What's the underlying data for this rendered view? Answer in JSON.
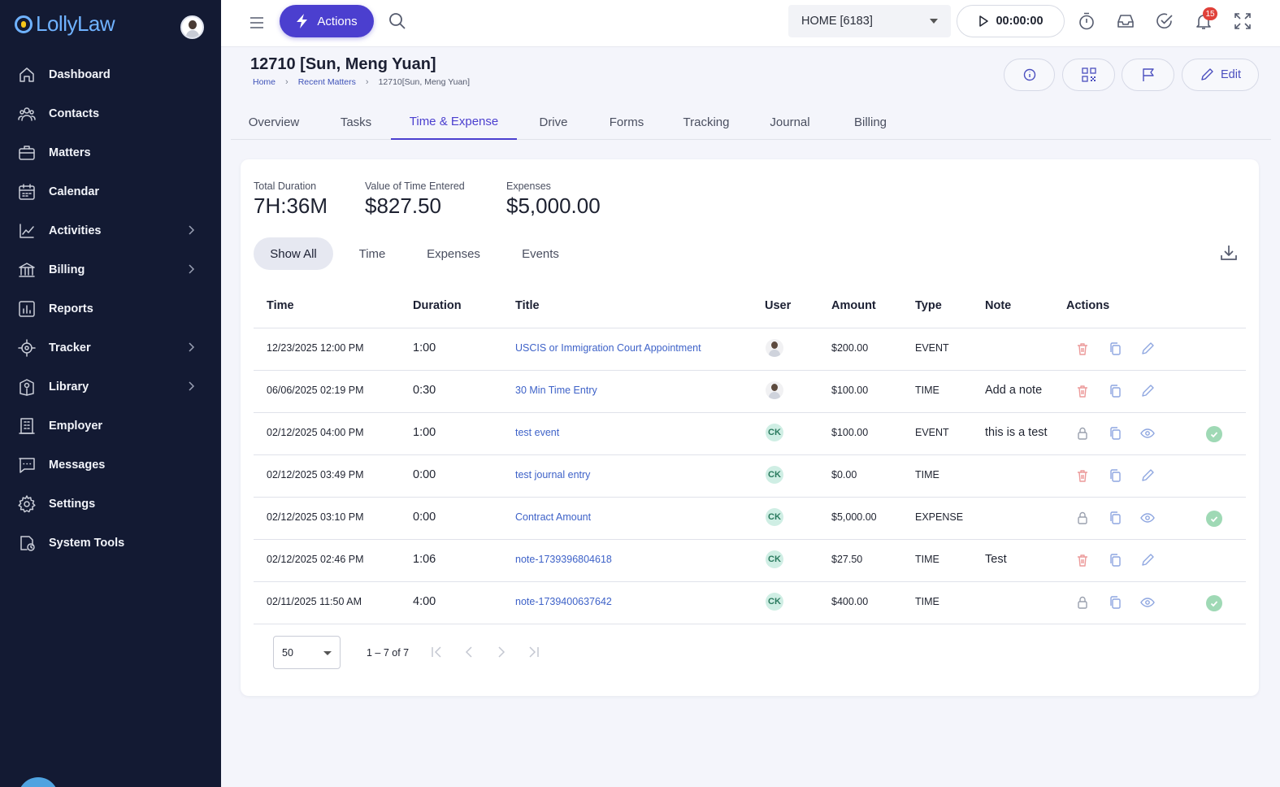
{
  "app": {
    "name": "LollyLaw"
  },
  "sidebar": {
    "items": [
      {
        "label": "Dashboard",
        "icon": "home-icon",
        "has_submenu": false
      },
      {
        "label": "Contacts",
        "icon": "contacts-icon",
        "has_submenu": false
      },
      {
        "label": "Matters",
        "icon": "briefcase-icon",
        "has_submenu": false
      },
      {
        "label": "Calendar",
        "icon": "calendar-icon",
        "has_submenu": false
      },
      {
        "label": "Activities",
        "icon": "activity-chart-icon",
        "has_submenu": true
      },
      {
        "label": "Billing",
        "icon": "bank-icon",
        "has_submenu": true
      },
      {
        "label": "Reports",
        "icon": "bar-chart-icon",
        "has_submenu": false
      },
      {
        "label": "Tracker",
        "icon": "target-icon",
        "has_submenu": true
      },
      {
        "label": "Library",
        "icon": "library-icon",
        "has_submenu": true
      },
      {
        "label": "Employer",
        "icon": "building-icon",
        "has_submenu": false
      },
      {
        "label": "Messages",
        "icon": "message-icon",
        "has_submenu": false
      },
      {
        "label": "Settings",
        "icon": "gear-icon",
        "has_submenu": false
      },
      {
        "label": "System Tools",
        "icon": "system-tools-icon",
        "has_submenu": false
      }
    ]
  },
  "topbar": {
    "actions_label": "Actions",
    "location_select": "HOME [6183]",
    "timer": "00:00:00",
    "notifications_count": "15"
  },
  "header": {
    "title": "12710 [Sun, Meng Yuan]",
    "breadcrumb": [
      "Home",
      "Recent Matters",
      "12710[Sun, Meng Yuan]"
    ],
    "edit_label": "Edit"
  },
  "tabs": [
    {
      "label": "Overview",
      "active": false
    },
    {
      "label": "Tasks",
      "active": false
    },
    {
      "label": "Time & Expense",
      "active": true
    },
    {
      "label": "Drive",
      "active": false
    },
    {
      "label": "Forms",
      "active": false
    },
    {
      "label": "Tracking",
      "active": false
    },
    {
      "label": "Journal",
      "active": false
    },
    {
      "label": "Billing",
      "active": false
    }
  ],
  "summary": {
    "total_duration": {
      "label": "Total Duration",
      "value": "7H:36M"
    },
    "time_value": {
      "label": "Value of Time Entered",
      "value": "$827.50"
    },
    "expenses": {
      "label": "Expenses",
      "value": "$5,000.00"
    }
  },
  "filters": [
    {
      "label": "Show All",
      "active": true
    },
    {
      "label": "Time",
      "active": false
    },
    {
      "label": "Expenses",
      "active": false
    },
    {
      "label": "Events",
      "active": false
    }
  ],
  "table": {
    "columns": [
      "Time",
      "Duration",
      "Title",
      "User",
      "Amount",
      "Type",
      "Note",
      "Actions"
    ],
    "rows": [
      {
        "time": "12/23/2025 12:00 PM",
        "duration": "1:00",
        "title": "USCIS or Immigration Court Appointment",
        "user": "",
        "amount": "$200.00",
        "type": "EVENT",
        "note": "",
        "locked": false,
        "approved": false
      },
      {
        "time": "06/06/2025 02:19 PM",
        "duration": "0:30",
        "title": "30 Min Time Entry",
        "user": "",
        "amount": "$100.00",
        "type": "TIME",
        "note": "Add a note",
        "locked": false,
        "approved": false
      },
      {
        "time": "02/12/2025 04:00 PM",
        "duration": "1:00",
        "title": "test event",
        "user": "CK",
        "amount": "$100.00",
        "type": "EVENT",
        "note": "this is a test",
        "locked": true,
        "approved": true
      },
      {
        "time": "02/12/2025 03:49 PM",
        "duration": "0:00",
        "title": "test journal entry",
        "user": "CK",
        "amount": "$0.00",
        "type": "TIME",
        "note": "",
        "locked": false,
        "approved": false
      },
      {
        "time": "02/12/2025 03:10 PM",
        "duration": "0:00",
        "title": "Contract Amount",
        "user": "CK",
        "amount": "$5,000.00",
        "type": "EXPENSE",
        "note": "",
        "locked": true,
        "approved": true
      },
      {
        "time": "02/12/2025 02:46 PM",
        "duration": "1:06",
        "title": "note-1739396804618",
        "user": "CK",
        "amount": "$27.50",
        "type": "TIME",
        "note": "Test",
        "locked": false,
        "approved": false
      },
      {
        "time": "02/11/2025 11:50 AM",
        "duration": "4:00",
        "title": "note-1739400637642",
        "user": "CK",
        "amount": "$400.00",
        "type": "TIME",
        "note": "",
        "locked": true,
        "approved": true
      }
    ]
  },
  "pagination": {
    "page_size": "50",
    "range": "1 – 7 of 7"
  },
  "colors": {
    "sidebar_bg": "#131a33",
    "accent": "#4b3fcf",
    "link": "#3e62c8",
    "delete": "#e88a8a",
    "approved": "#9fd9b5"
  }
}
